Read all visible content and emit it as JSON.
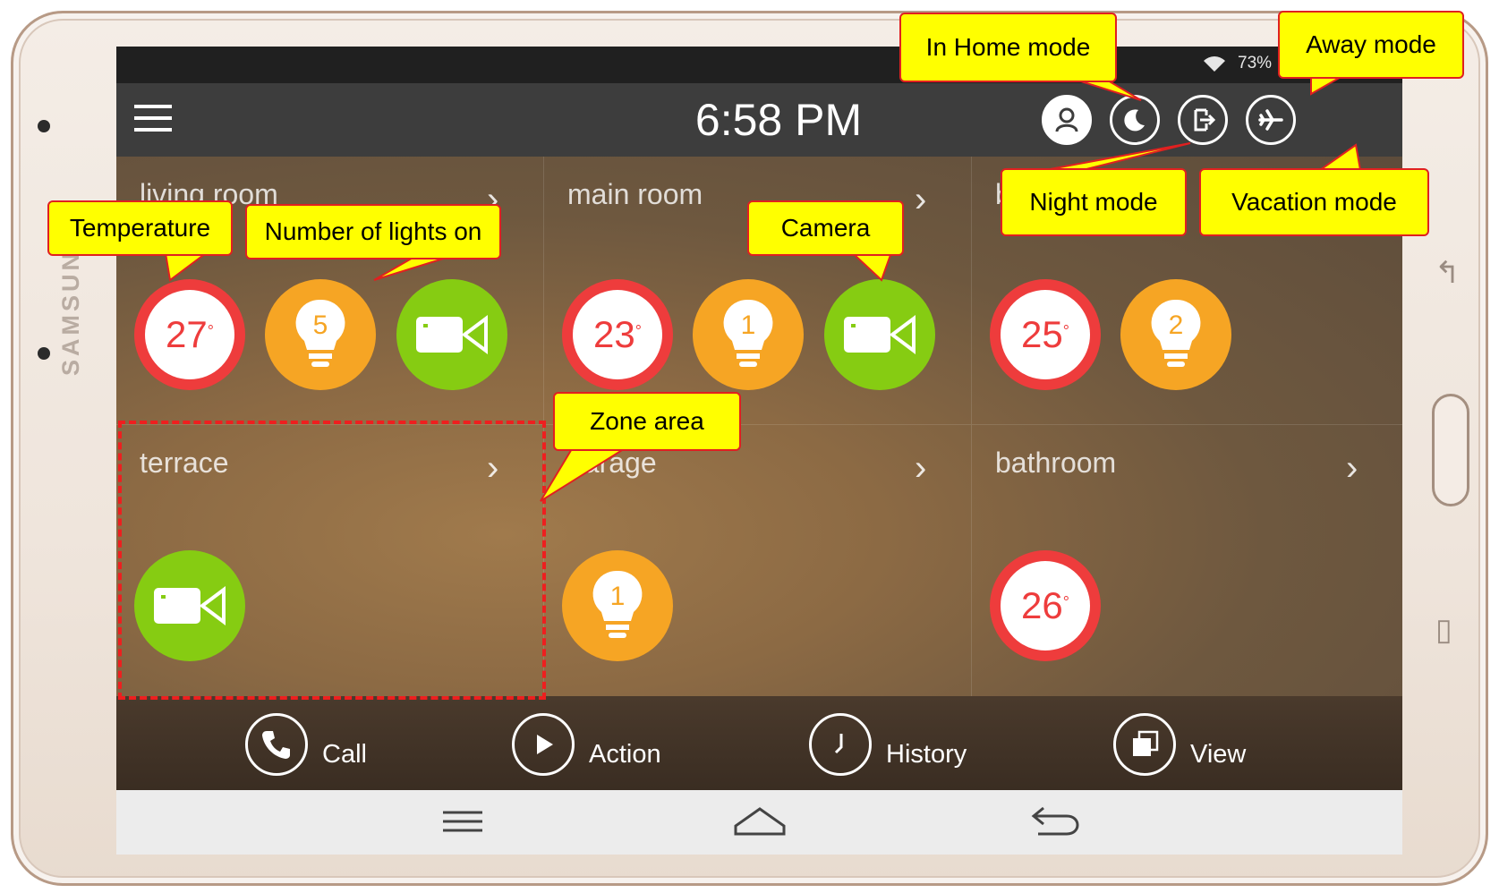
{
  "device": {
    "brand": "SAMSUNG"
  },
  "status": {
    "battery": "73%"
  },
  "header": {
    "time": "6:58 PM"
  },
  "modes": [
    "home-mode",
    "night-mode",
    "away-mode",
    "vacation-mode"
  ],
  "zones": [
    {
      "name": "living room",
      "temperature": "27",
      "lights": "5",
      "camera": true
    },
    {
      "name": "main room",
      "temperature": "23",
      "lights": "1",
      "camera": true
    },
    {
      "name": "bedroom",
      "temperature": "25",
      "lights": "2",
      "camera": false
    },
    {
      "name": "terrace",
      "camera": true
    },
    {
      "name": "garage",
      "lights": "1"
    },
    {
      "name": "bathroom",
      "temperature": "26"
    }
  ],
  "bottom_bar": {
    "call": "Call",
    "action": "Action",
    "history": "History",
    "view": "View"
  },
  "callouts": {
    "in_home_mode": "In Home mode",
    "away_mode": "Away mode",
    "night_mode": "Night mode",
    "vacation_mode": "Vacation mode",
    "temperature": "Temperature",
    "number_of_lights_on": "Number of lights on",
    "camera": "Camera",
    "zone_area": "Zone area"
  },
  "colors": {
    "temperature": "#ee3c3c",
    "light": "#f6a524",
    "camera": "#86cc12",
    "callout_fill": "#ffff00",
    "callout_border": "#e02020"
  }
}
